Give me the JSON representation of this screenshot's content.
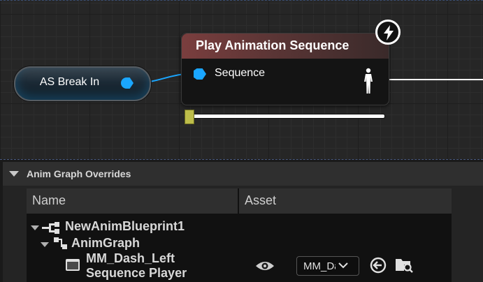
{
  "graph": {
    "break_node": {
      "label": "AS Break In"
    },
    "play_node": {
      "title": "Play Animation Sequence",
      "pins": [
        {
          "label": "Sequence"
        }
      ],
      "header_color": "#7a3e3e",
      "pin_color": "#1aa6ff"
    },
    "icons": [
      "lightning-icon",
      "pose-icon"
    ]
  },
  "overrides_panel": {
    "title": "Anim Graph Overrides",
    "columns": {
      "name": "Name",
      "asset": "Asset"
    },
    "tree": {
      "blueprint": "NewAnimBlueprint1",
      "graph": "AnimGraph",
      "node_line1": "MM_Dash_Left",
      "node_line2": "Sequence Player"
    },
    "asset_value": "MM_Dash_Left",
    "icons": [
      "eye-icon",
      "chevron-down-icon",
      "use-selected-icon",
      "browse-icon"
    ]
  }
}
